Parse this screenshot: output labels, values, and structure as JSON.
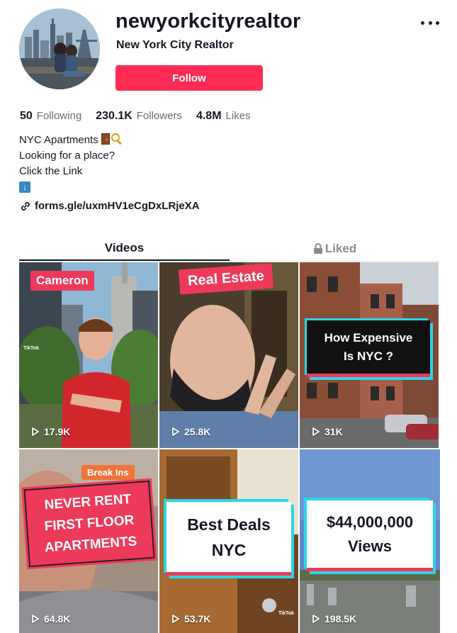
{
  "profile": {
    "username": "newyorkcityrealtor",
    "display_name": "New York City Realtor",
    "follow_label": "Follow",
    "more_icon": "more-dots-icon"
  },
  "stats": [
    {
      "value": "50",
      "label": "Following"
    },
    {
      "value": "230.1K",
      "label": "Followers"
    },
    {
      "value": "4.8M",
      "label": "Likes"
    }
  ],
  "bio": {
    "line1": "NYC Apartments",
    "line2": "Looking for a place?",
    "line3": "Click the Link",
    "emojis": [
      "door-emoji",
      "key-emoji",
      "down-arrow-emoji"
    ]
  },
  "link": {
    "text": "forms.gle/uxmHV1eCgDxLRjeXA",
    "icon": "link-icon"
  },
  "tabs": [
    {
      "label": "Videos",
      "active": true
    },
    {
      "label": "Liked",
      "active": false,
      "icon": "lock-icon"
    }
  ],
  "videos": [
    {
      "views": "17.9K",
      "overlay": "Cameron",
      "watermark": "TikTok"
    },
    {
      "views": "25.8K",
      "overlay": "Real Estate"
    },
    {
      "views": "31K",
      "overlay_line1": "How Expensive",
      "overlay_line2": "Is NYC ?"
    },
    {
      "views": "64.8K",
      "tag": "Break Ins",
      "overlay_line1": "NEVER RENT",
      "overlay_line2": "FIRST FLOOR",
      "overlay_line3": "APARTMENTS"
    },
    {
      "views": "53.7K",
      "overlay_line1": "Best Deals",
      "overlay_line2": "NYC",
      "watermark": "TikTok"
    },
    {
      "views": "198.5K",
      "overlay_line1": "$44,000,000",
      "overlay_line2": "Views"
    }
  ],
  "colors": {
    "accent": "#fe2c55",
    "text": "#161823",
    "muted": "#6b6c73"
  }
}
